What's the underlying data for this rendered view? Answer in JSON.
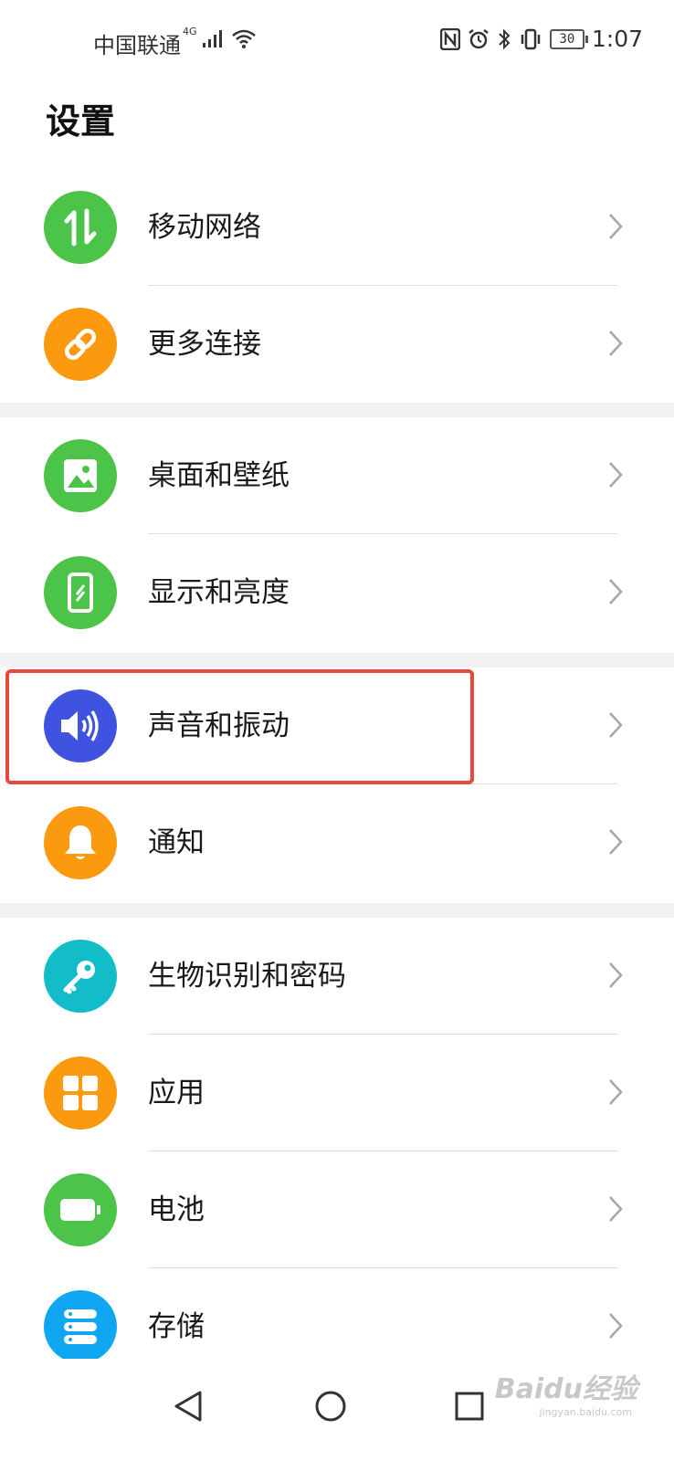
{
  "status_bar": {
    "carrier": "中国联通",
    "network": "4G",
    "battery": "30",
    "time": "1:07"
  },
  "page_title": "设置",
  "colors": {
    "green": "#4cc44a",
    "orange": "#fb9a0e",
    "blue": "#3f53e0",
    "teal": "#13bcc9",
    "sky": "#10a6f2",
    "highlight": "#e74a3c"
  },
  "groups": [
    {
      "items": [
        {
          "label": "移动网络",
          "icon": "mobile-network-icon",
          "color": "#4cc44a"
        },
        {
          "label": "更多连接",
          "icon": "link-icon",
          "color": "#fb9a0e"
        }
      ]
    },
    {
      "items": [
        {
          "label": "桌面和壁纸",
          "icon": "image-icon",
          "color": "#4cc44a"
        },
        {
          "label": "显示和亮度",
          "icon": "display-icon",
          "color": "#4cc44a"
        }
      ]
    },
    {
      "items": [
        {
          "label": "声音和振动",
          "icon": "speaker-icon",
          "color": "#3f53e0",
          "highlighted": true
        },
        {
          "label": "通知",
          "icon": "bell-icon",
          "color": "#fb9a0e"
        }
      ]
    },
    {
      "items": [
        {
          "label": "生物识别和密码",
          "icon": "key-icon",
          "color": "#13bcc9"
        },
        {
          "label": "应用",
          "icon": "apps-icon",
          "color": "#fb9a0e"
        },
        {
          "label": "电池",
          "icon": "battery-icon",
          "color": "#4cc44a"
        },
        {
          "label": "存储",
          "icon": "storage-icon",
          "color": "#10a6f2"
        }
      ]
    }
  ],
  "nav_bar": {
    "buttons": [
      "back-icon",
      "home-icon",
      "recents-icon"
    ]
  },
  "watermark": {
    "text": "Baidu经验",
    "sub": "jingyan.baidu.com"
  }
}
